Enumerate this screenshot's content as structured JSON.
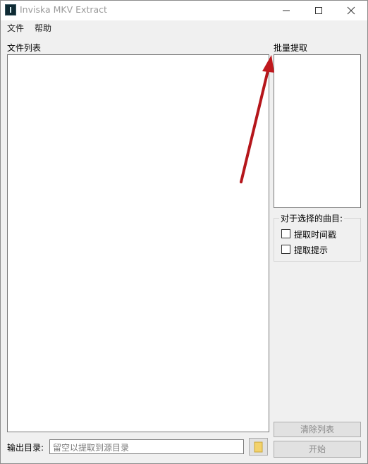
{
  "window": {
    "title": "Inviska MKV Extract"
  },
  "menu": {
    "items": [
      "文件",
      "帮助"
    ]
  },
  "file_list": {
    "label": "文件列表"
  },
  "batch": {
    "label": "批量提取",
    "group_title": "对于选择的曲目:",
    "options": [
      {
        "label": "提取时间戳",
        "checked": false
      },
      {
        "label": "提取提示",
        "checked": false
      }
    ]
  },
  "buttons": {
    "clear_list": "清除列表",
    "start": "开始"
  },
  "output": {
    "label": "输出目录:",
    "placeholder": "留空以提取到源目录",
    "value": ""
  }
}
